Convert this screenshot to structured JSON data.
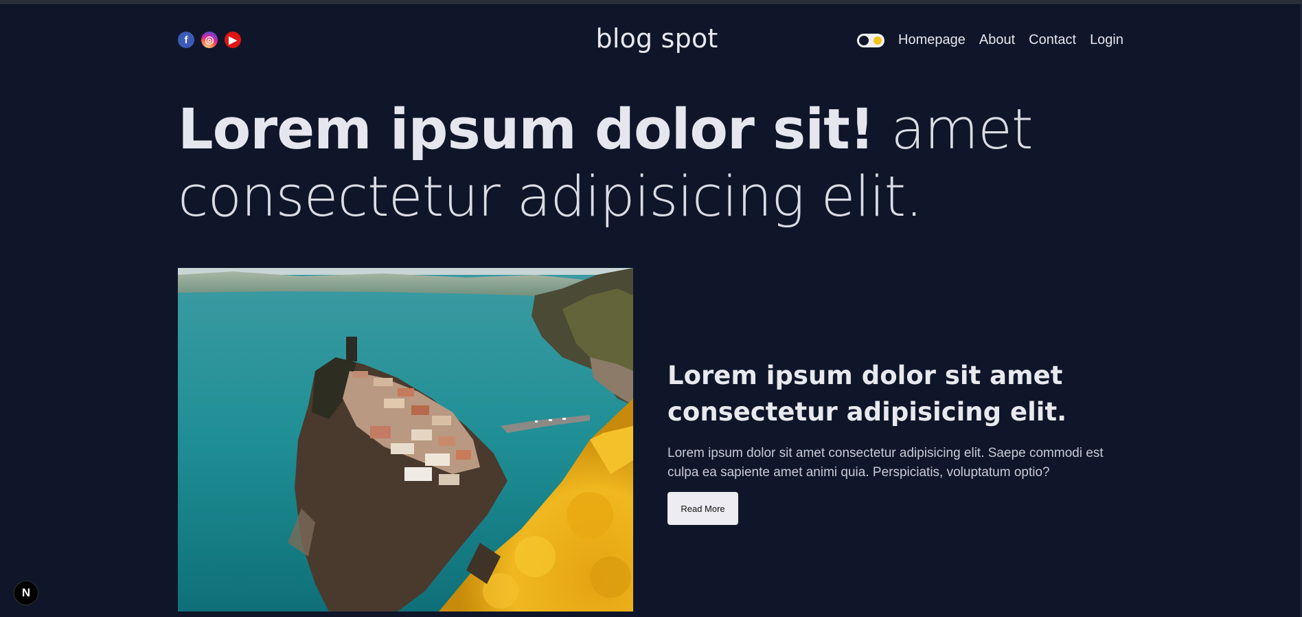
{
  "header": {
    "brand": "blog spot",
    "socials": [
      {
        "icon": "facebook-icon",
        "glyph": "f",
        "color": "#3b5bb5"
      },
      {
        "icon": "instagram-icon",
        "glyph": "◎",
        "color": "#d6249f"
      },
      {
        "icon": "youtube-icon",
        "glyph": "▶",
        "color": "#e01414"
      }
    ],
    "theme_toggle": {
      "state": "dark",
      "knob_color": "#0f1629",
      "sun_color": "#f5c518"
    },
    "nav": [
      "Homepage",
      "About",
      "Contact",
      "Login"
    ]
  },
  "hero": {
    "bold_text": "Lorem ipsum dolor sit!",
    "light_text": "amet consectetur adipisicing elit."
  },
  "post": {
    "image_alt": "Coastal cliffside village above turquoise sea with yellow flowers",
    "title": "Lorem ipsum dolor sit amet consectetur adipisicing elit.",
    "description": "Lorem ipsum dolor sit amet consectetur adipisicing elit. Saepe commodi est culpa ea sapiente amet animi quia. Perspiciatis, voluptatum optio?",
    "button_label": "Read More"
  },
  "dev_indicator": {
    "label": "N"
  },
  "colors": {
    "background": "#0f1629",
    "text": "#e6e6ee",
    "button_bg": "#ececf2"
  }
}
